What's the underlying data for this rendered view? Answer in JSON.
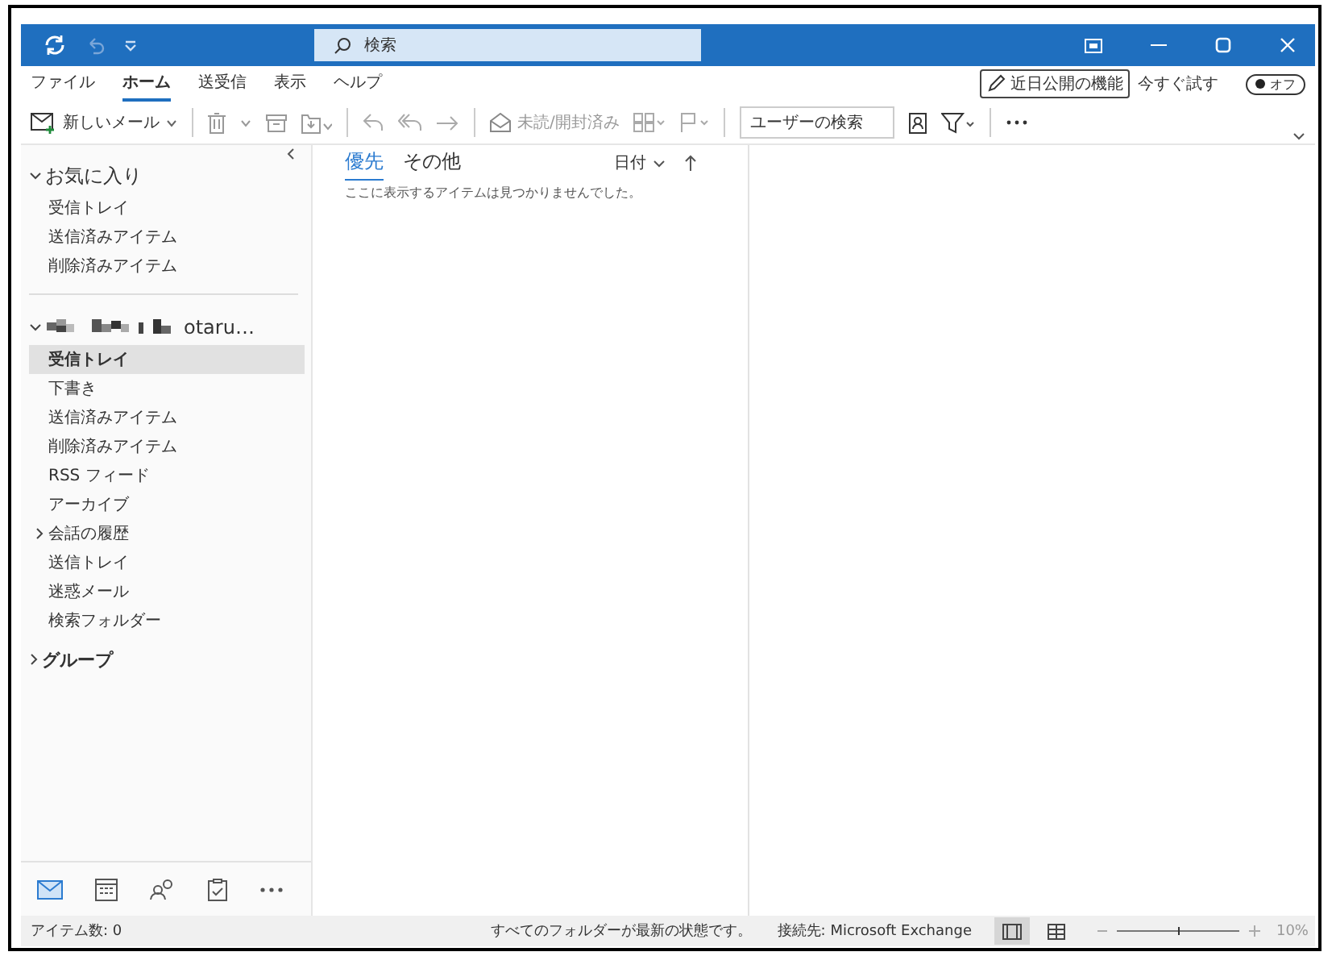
{
  "title_bar": {
    "search_placeholder": "検索"
  },
  "menu_tabs": [
    {
      "label": "ファイル",
      "selected": false
    },
    {
      "label": "ホーム",
      "selected": true
    },
    {
      "label": "送受信",
      "selected": false
    },
    {
      "label": "表示",
      "selected": false
    },
    {
      "label": "ヘルプ",
      "selected": false
    }
  ],
  "coming_soon": {
    "button": "近日公開の機能",
    "try_label": "今すぐ試す",
    "toggle_label": "オフ",
    "on": false
  },
  "toolbar": {
    "new_mail": "新しいメール",
    "mark_read": "未読/開封済み",
    "people_search_placeholder": "ユーザーの検索"
  },
  "favorites": {
    "title": "お気に入り",
    "expanded": true,
    "items": [
      {
        "label": "受信トレイ",
        "selected": false
      },
      {
        "label": "送信済みアイテム",
        "selected": false
      },
      {
        "label": "削除済みアイテム",
        "selected": false
      }
    ]
  },
  "account": {
    "name": "otaru…",
    "expanded": true,
    "folders": [
      {
        "label": "受信トレイ",
        "selected": true,
        "expandable": false
      },
      {
        "label": "下書き",
        "selected": false,
        "expandable": false
      },
      {
        "label": "送信済みアイテム",
        "selected": false,
        "expandable": false
      },
      {
        "label": "削除済みアイテム",
        "selected": false,
        "expandable": false
      },
      {
        "label": "RSS フィード",
        "selected": false,
        "expandable": false
      },
      {
        "label": "アーカイブ",
        "selected": false,
        "expandable": false
      },
      {
        "label": "会話の履歴",
        "selected": false,
        "expandable": true
      },
      {
        "label": "送信トレイ",
        "selected": false,
        "expandable": false
      },
      {
        "label": "迷惑メール",
        "selected": false,
        "expandable": false
      },
      {
        "label": "検索フォルダー",
        "selected": false,
        "expandable": false
      }
    ]
  },
  "groups": {
    "title": "グループ",
    "expanded": false
  },
  "nav": [
    {
      "kind": "mail",
      "selected": true
    },
    {
      "kind": "calendar",
      "selected": false
    },
    {
      "kind": "people",
      "selected": false
    },
    {
      "kind": "tasks",
      "selected": false
    },
    {
      "kind": "more",
      "selected": false
    }
  ],
  "message_list": {
    "tabs": [
      {
        "label": "優先",
        "selected": true
      },
      {
        "label": "その他",
        "selected": false
      }
    ],
    "sort": "日付",
    "empty_text": "ここに表示するアイテムは見つかりませんでした。"
  },
  "status_bar": {
    "item_count": "アイテム数: 0",
    "sync_status": "すべてのフォルダーが最新の状態です。",
    "connection": "接続先: Microsoft Exchange",
    "views": [
      {
        "kind": "normal",
        "selected": true
      },
      {
        "kind": "reading",
        "selected": false
      }
    ],
    "zoom": {
      "level": 0.5,
      "reading": "10%"
    }
  }
}
